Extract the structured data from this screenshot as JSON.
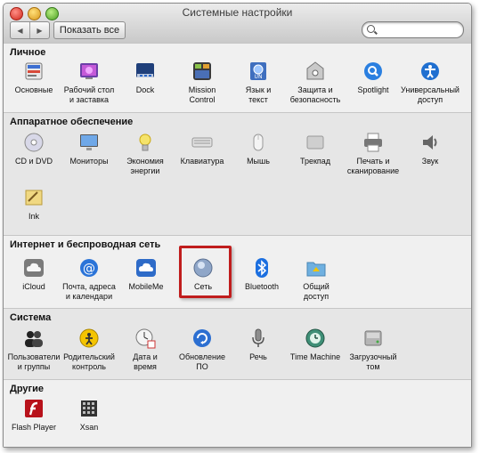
{
  "window": {
    "title": "Системные настройки",
    "show_all_label": "Показать все",
    "back_glyph": "◀",
    "forward_glyph": "▶",
    "search_placeholder": "",
    "highlight_color": "#c01d1d"
  },
  "sections": [
    {
      "title": "Личное",
      "items": [
        {
          "label": "Основные",
          "icon": "general-icon"
        },
        {
          "label": "Рабочий стол\nи заставка",
          "icon": "desktop-screensaver-icon"
        },
        {
          "label": "Dock",
          "icon": "dock-icon"
        },
        {
          "label": "Mission\nControl",
          "icon": "mission-control-icon"
        },
        {
          "label": "Язык и\nтекст",
          "icon": "language-text-icon"
        },
        {
          "label": "Защита и\nбезопасность",
          "icon": "security-icon"
        },
        {
          "label": "Spotlight",
          "icon": "spotlight-icon"
        },
        {
          "label": "Универсальный\nдоступ",
          "icon": "universal-access-icon"
        }
      ]
    },
    {
      "title": "Аппаратное обеспечение",
      "items": [
        {
          "label": "CD и DVD",
          "icon": "cd-dvd-icon"
        },
        {
          "label": "Мониторы",
          "icon": "displays-icon"
        },
        {
          "label": "Экономия\nэнергии",
          "icon": "energy-saver-icon"
        },
        {
          "label": "Клавиатура",
          "icon": "keyboard-icon"
        },
        {
          "label": "Мышь",
          "icon": "mouse-icon"
        },
        {
          "label": "Трекпад",
          "icon": "trackpad-icon"
        },
        {
          "label": "Печать и\nсканирование",
          "icon": "print-scan-icon"
        },
        {
          "label": "Звук",
          "icon": "sound-icon"
        },
        {
          "label": "Ink",
          "icon": "ink-icon"
        }
      ]
    },
    {
      "title": "Интернет и беспроводная сеть",
      "items": [
        {
          "label": "iCloud",
          "icon": "icloud-icon"
        },
        {
          "label": "Почта, адреса\nи календари",
          "icon": "mail-contacts-calendars-icon"
        },
        {
          "label": "MobileMe",
          "icon": "mobileme-icon"
        },
        {
          "label": "Сеть",
          "icon": "network-icon"
        },
        {
          "label": "Bluetooth",
          "icon": "bluetooth-icon"
        },
        {
          "label": "Общий\nдоступ",
          "icon": "sharing-icon"
        }
      ]
    },
    {
      "title": "Система",
      "items": [
        {
          "label": "Пользователи\nи группы",
          "icon": "users-groups-icon"
        },
        {
          "label": "Родительский\nконтроль",
          "icon": "parental-controls-icon"
        },
        {
          "label": "Дата и\nвремя",
          "icon": "date-time-icon"
        },
        {
          "label": "Обновление\nПО",
          "icon": "software-update-icon"
        },
        {
          "label": "Речь",
          "icon": "speech-icon"
        },
        {
          "label": "Time Machine",
          "icon": "time-machine-icon"
        },
        {
          "label": "Загрузочный\nтом",
          "icon": "startup-disk-icon"
        }
      ]
    },
    {
      "title": "Другие",
      "items": [
        {
          "label": "Flash Player",
          "icon": "flash-player-icon"
        },
        {
          "label": "Xsan",
          "icon": "xsan-icon"
        }
      ]
    }
  ]
}
